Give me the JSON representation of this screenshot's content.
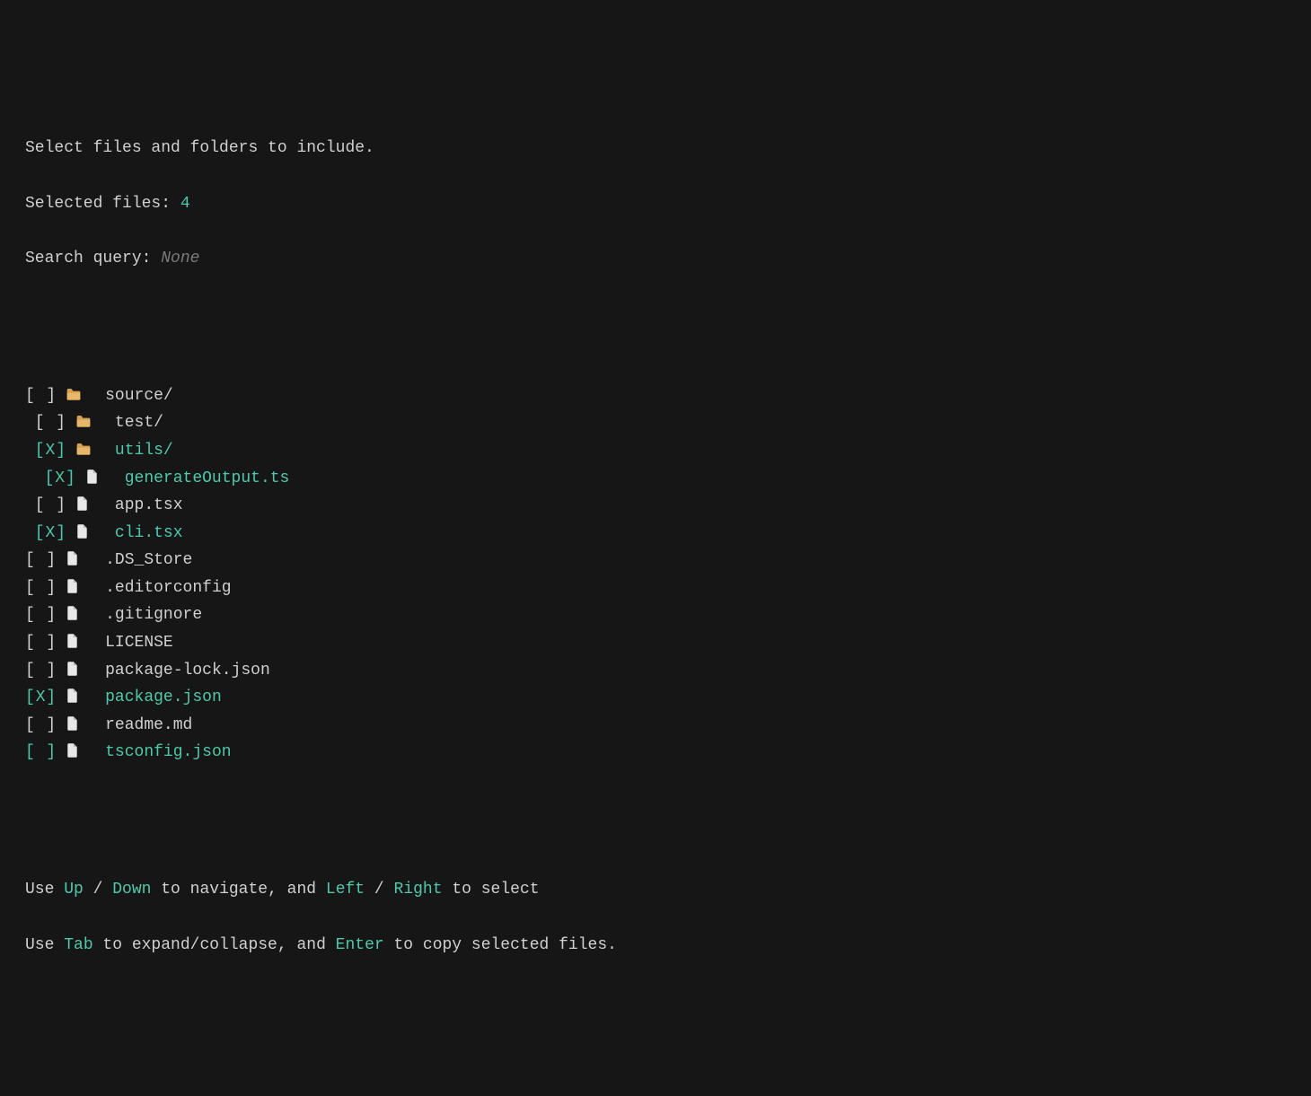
{
  "header": {
    "title": "Select files and folders to include.",
    "selected_label": "Selected files: ",
    "selected_count": "4",
    "search_label": "Search query: ",
    "search_value": "None"
  },
  "checkbox_unchecked": "[ ]",
  "checkbox_checked": "[X]",
  "tree": [
    {
      "indent": 0,
      "checked": false,
      "type": "folder",
      "name": "source/",
      "selected": false,
      "highlight": false
    },
    {
      "indent": 1,
      "checked": false,
      "type": "folder",
      "name": "test/",
      "selected": false,
      "highlight": false
    },
    {
      "indent": 1,
      "checked": true,
      "type": "folder",
      "name": "utils/",
      "selected": true,
      "highlight": false
    },
    {
      "indent": 2,
      "checked": true,
      "type": "file",
      "name": "generateOutput.ts",
      "selected": true,
      "highlight": false
    },
    {
      "indent": 1,
      "checked": false,
      "type": "file",
      "name": "app.tsx",
      "selected": false,
      "highlight": false
    },
    {
      "indent": 1,
      "checked": true,
      "type": "file",
      "name": "cli.tsx",
      "selected": true,
      "highlight": false
    },
    {
      "indent": 0,
      "checked": false,
      "type": "file",
      "name": ".DS_Store",
      "selected": false,
      "highlight": false
    },
    {
      "indent": 0,
      "checked": false,
      "type": "file",
      "name": ".editorconfig",
      "selected": false,
      "highlight": false
    },
    {
      "indent": 0,
      "checked": false,
      "type": "file",
      "name": ".gitignore",
      "selected": false,
      "highlight": false
    },
    {
      "indent": 0,
      "checked": false,
      "type": "file",
      "name": "LICENSE",
      "selected": false,
      "highlight": false
    },
    {
      "indent": 0,
      "checked": false,
      "type": "file",
      "name": "package-lock.json",
      "selected": false,
      "highlight": false
    },
    {
      "indent": 0,
      "checked": true,
      "type": "file",
      "name": "package.json",
      "selected": true,
      "highlight": false
    },
    {
      "indent": 0,
      "checked": false,
      "type": "file",
      "name": "readme.md",
      "selected": false,
      "highlight": false
    },
    {
      "indent": 0,
      "checked": false,
      "type": "file",
      "name": "tsconfig.json",
      "selected": false,
      "highlight": true
    }
  ],
  "help": {
    "line1": {
      "t1": "Use ",
      "k1": "Up",
      "t2": " / ",
      "k2": "Down",
      "t3": " to navigate, and ",
      "k3": "Left",
      "t4": " / ",
      "k4": "Right",
      "t5": " to select"
    },
    "line2": {
      "t1": "Use ",
      "k1": "Tab",
      "t2": " to expand/collapse, and ",
      "k2": "Enter",
      "t3": " to copy selected files."
    }
  }
}
